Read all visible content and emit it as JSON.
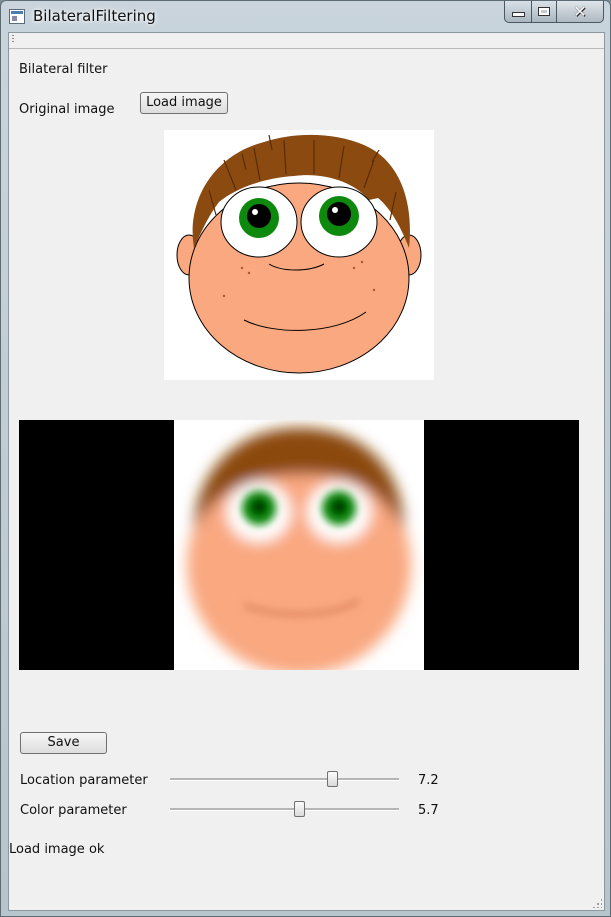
{
  "window": {
    "title": "BilateralFiltering"
  },
  "header": {
    "heading": "Bilateral filter"
  },
  "original": {
    "label": "Original image",
    "load_button": "Load image"
  },
  "actions": {
    "save_button": "Save"
  },
  "params": {
    "location": {
      "label": "Location parameter",
      "value": "7.2",
      "level": 0.72
    },
    "color": {
      "label": "Color parameter",
      "value": "5.7",
      "level": 0.57
    }
  },
  "status": {
    "text": "Load image ok"
  },
  "colors": {
    "skin": "#f9a880",
    "hair": "#8b4a10",
    "iris": "#0d8a0d",
    "pupil": "#000000",
    "window_bg": "#f0f0f0"
  }
}
